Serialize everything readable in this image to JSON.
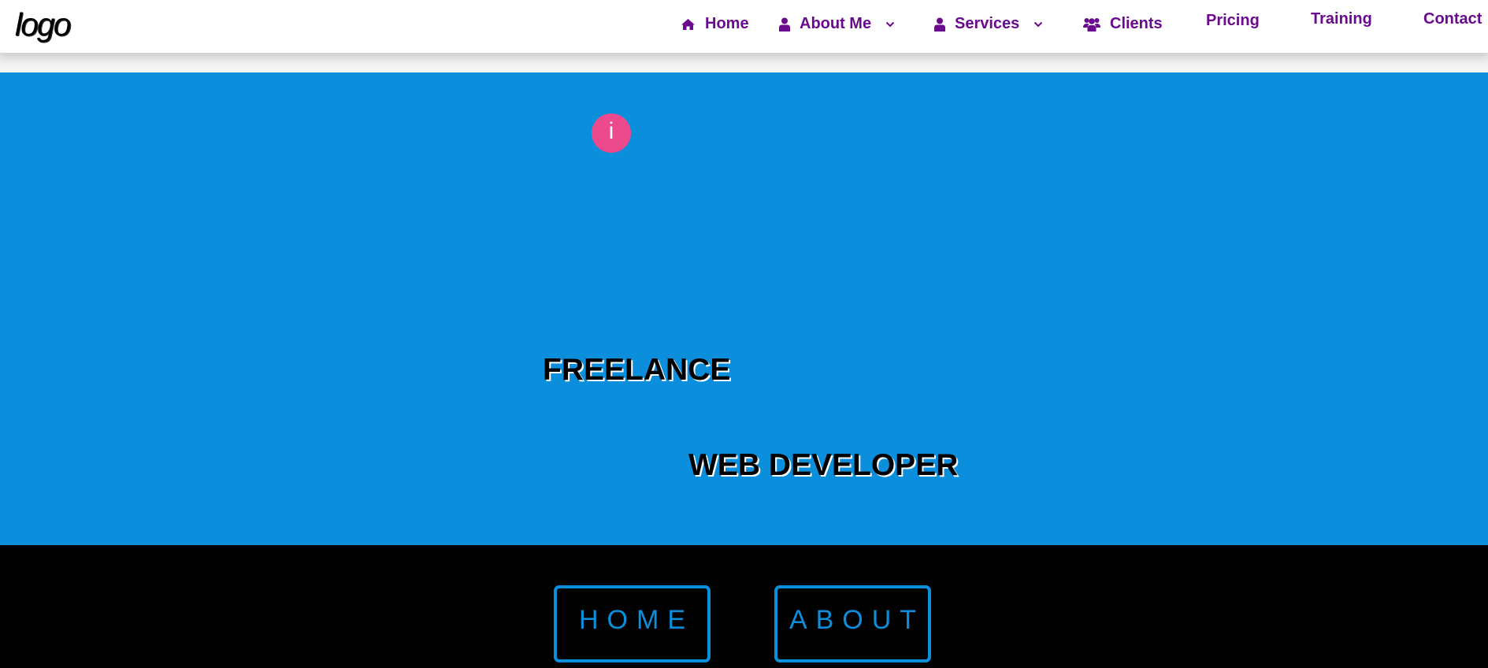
{
  "header": {
    "logo_text": "logo",
    "nav": [
      {
        "label": "Home",
        "icon": "home-icon"
      },
      {
        "label": "About Me",
        "icon": "user-icon",
        "has_dropdown": true
      },
      {
        "label": "Services",
        "icon": "user-icon",
        "has_dropdown": true
      },
      {
        "label": "Clients",
        "icon": "users-icon"
      },
      {
        "label": "Pricing"
      },
      {
        "label": "Training"
      },
      {
        "label": "Contact"
      }
    ]
  },
  "hero": {
    "badge_text": "i",
    "title_line1": "FREELANCE",
    "title_line2": "WEB DEVELOPER"
  },
  "buttons": {
    "home_label": "HOME",
    "about_label": "ABOUT"
  },
  "colors": {
    "nav_text": "#6a0a8e",
    "hero_bg": "#0b8fdc",
    "badge_bg": "#ec4a8d",
    "band_bg": "#000000",
    "button_outline": "#0b8fdc"
  }
}
